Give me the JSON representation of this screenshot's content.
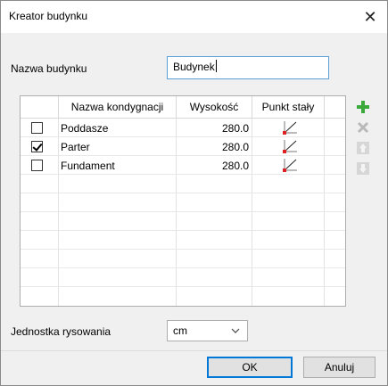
{
  "window": {
    "title": "Kreator budynku",
    "close_label": "✕"
  },
  "building": {
    "label": "Nazwa budynku",
    "value": "Budynek"
  },
  "table": {
    "columns": [
      "Nazwa kondygnacji",
      "Wysokość",
      "Punkt stały"
    ],
    "rows": [
      {
        "checked": false,
        "name": "Poddasze",
        "height": "280.0"
      },
      {
        "checked": true,
        "name": "Parter",
        "height": "280.0"
      },
      {
        "checked": false,
        "name": "Fundament",
        "height": "280.0"
      }
    ]
  },
  "side_buttons": [
    "plus-icon",
    "delete-icon",
    "arrow-up-icon",
    "arrow-down-icon"
  ],
  "unit": {
    "label": "Jednostka rysowania",
    "value": "cm"
  },
  "buttons": {
    "ok": "OK",
    "cancel": "Anuluj"
  },
  "colors": {
    "accent": "#0078d7",
    "add_green": "#3aa83a",
    "point_red": "#e02020"
  }
}
